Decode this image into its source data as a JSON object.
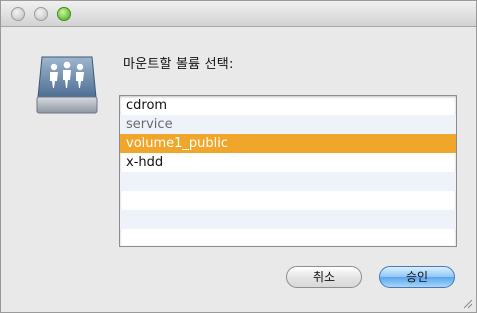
{
  "dialog": {
    "prompt": "마운트할 볼륨 선택:"
  },
  "volumes": {
    "items": [
      {
        "label": "cdrom"
      },
      {
        "label": "service"
      },
      {
        "label": "volume1_public"
      },
      {
        "label": "x-hdd"
      }
    ],
    "selected": "volume1_public"
  },
  "buttons": {
    "cancel_label": "취소",
    "ok_label": "승인"
  },
  "colors": {
    "selection": "#f0a62a",
    "ok_button": "#5aa6ec",
    "zoom_button": "#45a91a"
  },
  "icons": {
    "drive": "network-drive-icon",
    "traffic_lights": [
      "close-button",
      "minimize-button",
      "zoom-button"
    ]
  }
}
